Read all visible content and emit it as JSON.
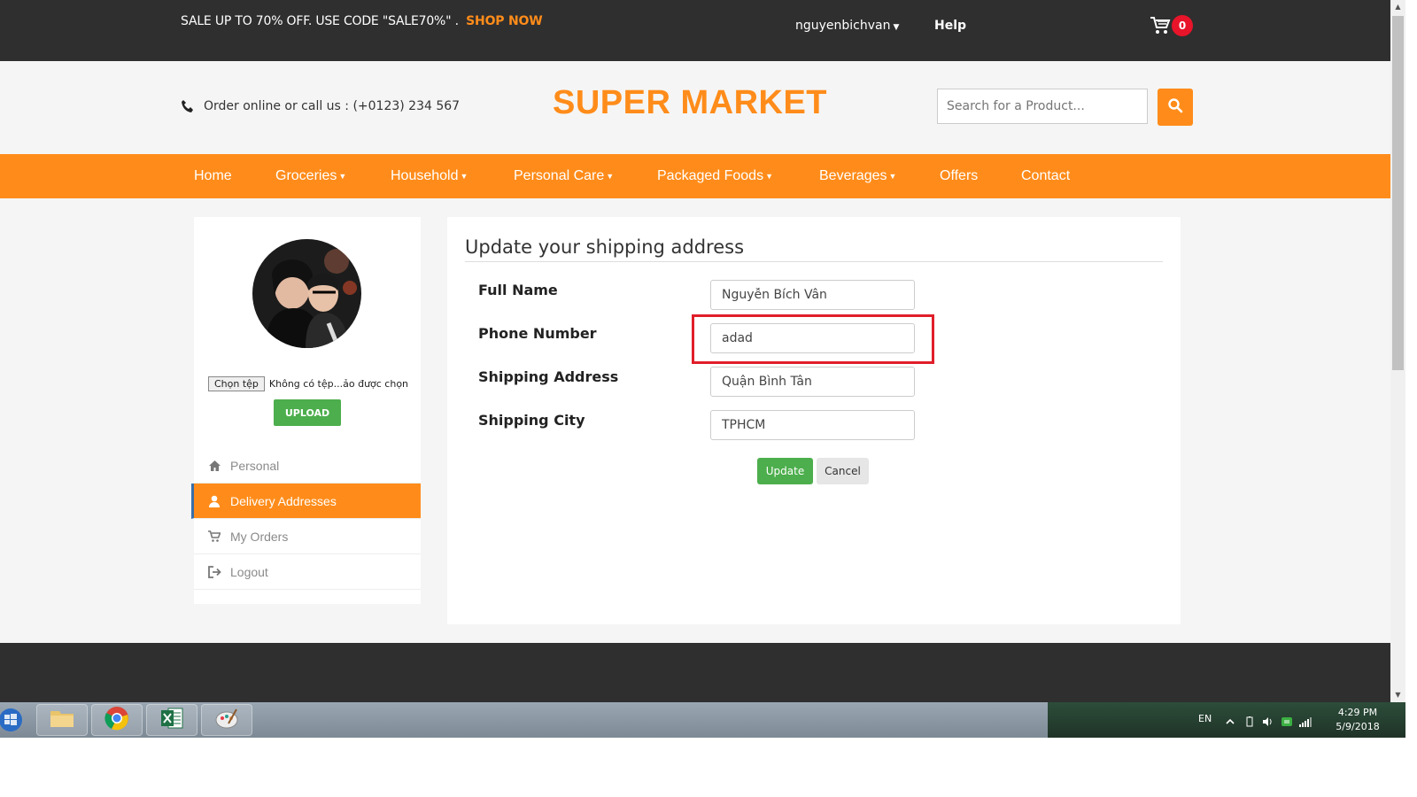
{
  "topbar": {
    "promo_text": "SALE UP TO 70% OFF. USE CODE \"SALE70%\" .",
    "promo_link": "SHOP NOW",
    "username": "nguyenbichvan",
    "help": "Help",
    "cart_count": "0"
  },
  "header": {
    "phone_text": "Order online or call us : (+0123) 234 567",
    "brand": "SUPER MARKET",
    "search_placeholder": "Search for a Product..."
  },
  "nav": {
    "items": [
      {
        "label": "Home",
        "dropdown": false
      },
      {
        "label": "Groceries",
        "dropdown": true
      },
      {
        "label": "Household",
        "dropdown": true
      },
      {
        "label": "Personal Care",
        "dropdown": true
      },
      {
        "label": "Packaged Foods",
        "dropdown": true
      },
      {
        "label": "Beverages",
        "dropdown": true
      },
      {
        "label": "Offers",
        "dropdown": false
      },
      {
        "label": "Contact",
        "dropdown": false
      }
    ]
  },
  "sidebar": {
    "file_button": "Chọn tệp",
    "file_status": "Không có tệp...ảo được chọn",
    "upload_label": "UPLOAD",
    "menu": [
      {
        "label": "Personal",
        "icon": "home-icon",
        "active": false
      },
      {
        "label": "Delivery Addresses",
        "icon": "user-icon",
        "active": true
      },
      {
        "label": "My Orders",
        "icon": "cart-icon",
        "active": false
      },
      {
        "label": "Logout",
        "icon": "logout-icon",
        "active": false
      }
    ]
  },
  "form": {
    "title": "Update your shipping address",
    "fields": [
      {
        "label": "Full Name",
        "value": "Nguyễn Bích Vân"
      },
      {
        "label": "Phone Number",
        "value": "adad"
      },
      {
        "label": "Shipping Address",
        "value": "Quận Bình Tân"
      },
      {
        "label": "Shipping City",
        "value": "TPHCM"
      }
    ],
    "update_label": "Update",
    "cancel_label": "Cancel"
  },
  "taskbar": {
    "lang": "EN",
    "time": "4:29 PM",
    "date": "5/9/2018"
  },
  "colors": {
    "accent": "#ff8c1a",
    "dark_bar": "#2f2f2f",
    "success": "#4cae4c",
    "highlight": "#e01e2a"
  }
}
